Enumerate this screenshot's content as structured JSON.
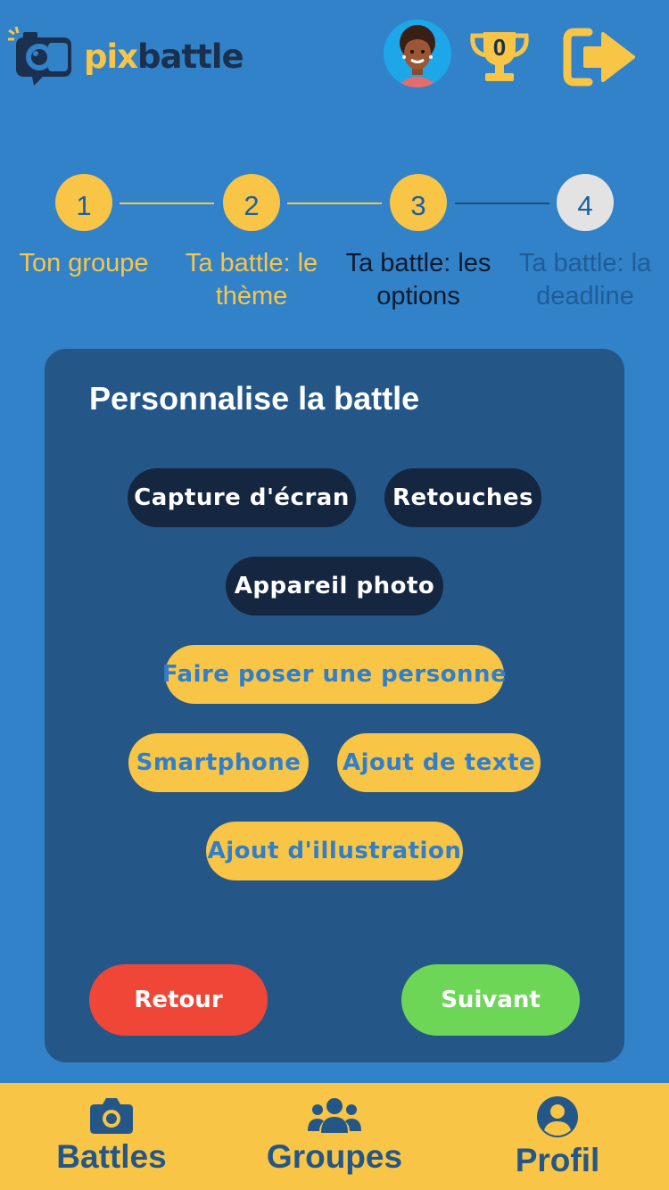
{
  "header": {
    "logo_pix": "pix",
    "logo_battle": "battle",
    "trophy_count": "0"
  },
  "stepper": {
    "steps": [
      {
        "number": "1",
        "label_line1": "Ton groupe",
        "label_line2": ""
      },
      {
        "number": "2",
        "label_line1": "Ta battle: le",
        "label_line2": "thème"
      },
      {
        "number": "3",
        "label_line1": "Ta battle: les",
        "label_line2": "options"
      },
      {
        "number": "4",
        "label_line1": "Ta battle: la",
        "label_line2": "deadline"
      }
    ]
  },
  "card": {
    "title": "Personnalise la battle",
    "options": [
      {
        "label": "Capture d'écran",
        "selected": true
      },
      {
        "label": "Retouches",
        "selected": true
      },
      {
        "label": "Appareil photo",
        "selected": true
      },
      {
        "label": "Faire poser une personne",
        "selected": false
      },
      {
        "label": "Smartphone",
        "selected": false
      },
      {
        "label": "Ajout de texte",
        "selected": false
      },
      {
        "label": "Ajout d'illustration",
        "selected": false
      }
    ],
    "back_label": "Retour",
    "next_label": "Suivant"
  },
  "tabbar": {
    "items": [
      {
        "label": "Battles",
        "icon": "camera-icon"
      },
      {
        "label": "Groupes",
        "icon": "users-icon"
      },
      {
        "label": "Profil",
        "icon": "user-circle-icon"
      }
    ]
  },
  "colors": {
    "background": "#3182c8",
    "card": "#245787",
    "accent_yellow": "#f8c547",
    "chip_selected": "#152640",
    "back_red": "#f04638",
    "next_green": "#6dd656",
    "step_inactive": "#e3e3e3"
  }
}
